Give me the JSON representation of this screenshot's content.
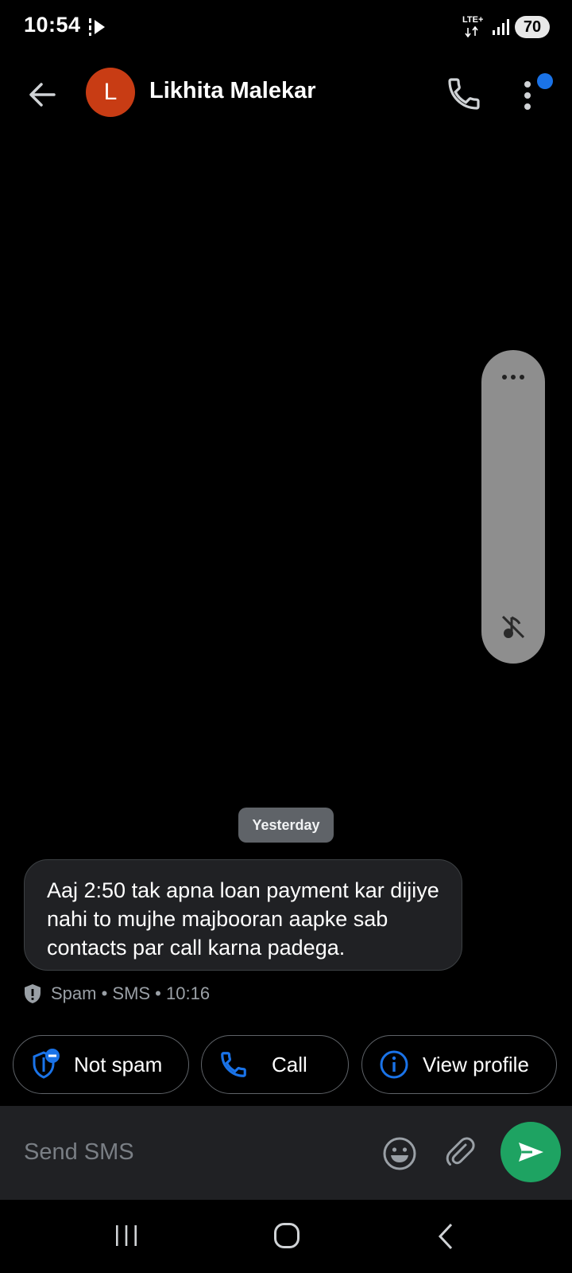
{
  "status_bar": {
    "time": "10:54",
    "network": "LTE+",
    "battery": "70"
  },
  "header": {
    "avatar_letter": "L",
    "avatar_color": "#c83c14",
    "contact_name": "Likhita Malekar"
  },
  "conversation": {
    "date_divider": "Yesterday",
    "message": {
      "text": "Aaj 2:50 tak apna loan payment kar dijiye nahi to mujhe majbooran aapke sab contacts par call karna padega.",
      "meta": "Spam • SMS • 10:16"
    }
  },
  "actions": {
    "not_spam": "Not spam",
    "call": "Call",
    "view_profile": "View profile"
  },
  "composer": {
    "placeholder": "Send SMS",
    "send_color": "#1ea362"
  },
  "icons": [
    "back-arrow-icon",
    "phone-icon",
    "more-vert-icon",
    "more-horiz-icon",
    "mute-icon",
    "shield-icon",
    "shield-minus-icon",
    "info-icon",
    "emoji-icon",
    "attach-icon",
    "send-icon",
    "recents-icon",
    "home-icon",
    "nav-back-icon"
  ]
}
